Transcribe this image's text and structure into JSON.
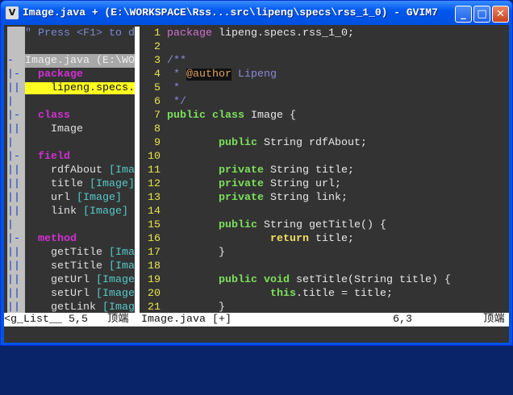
{
  "window": {
    "title": "Image.java + (E:\\WORKSPACE\\Rss...src\\lipeng\\specs\\rss_1_0) - GVIM7",
    "minimize": "_",
    "maximize": "□",
    "close": "✕",
    "icon": "vim-icon"
  },
  "taglist": {
    "lines": [
      {
        "fold": "",
        "text": "\" Press <F1> to d",
        "cls": "help"
      },
      {
        "fold": "",
        "text": "",
        "cls": ""
      },
      {
        "fold": "-",
        "text": "Image.java (E:\\WO",
        "cls": "hdr"
      },
      {
        "fold": "|-",
        "text": "  package",
        "cls": "mg"
      },
      {
        "fold": "||",
        "text": "    lipeng.specs.",
        "cls": "hl"
      },
      {
        "fold": "|",
        "text": "",
        "cls": ""
      },
      {
        "fold": "|-",
        "text": "  class",
        "cls": "mg"
      },
      {
        "fold": "||",
        "text": "    Image",
        "cls": ""
      },
      {
        "fold": "|",
        "text": "",
        "cls": ""
      },
      {
        "fold": "|-",
        "text": "  field",
        "cls": "mg"
      },
      {
        "fold": "||",
        "text": "    rdfAbout ",
        "cls": "",
        "tag": "[Ima"
      },
      {
        "fold": "||",
        "text": "    title ",
        "cls": "",
        "tag": "[Image]"
      },
      {
        "fold": "||",
        "text": "    url ",
        "cls": "",
        "tag": "[Image]"
      },
      {
        "fold": "||",
        "text": "    link ",
        "cls": "",
        "tag": "[Image]"
      },
      {
        "fold": "|",
        "text": "",
        "cls": ""
      },
      {
        "fold": "|-",
        "text": "  method",
        "cls": "mg"
      },
      {
        "fold": "||",
        "text": "    getTitle ",
        "cls": "",
        "tag": "[Ima"
      },
      {
        "fold": "||",
        "text": "    setTitle ",
        "cls": "",
        "tag": "[Ima"
      },
      {
        "fold": "||",
        "text": "    getUrl ",
        "cls": "",
        "tag": "[Image"
      },
      {
        "fold": "||",
        "text": "    setUrl ",
        "cls": "",
        "tag": "[Image"
      },
      {
        "fold": "||",
        "text": "    getLink ",
        "cls": "",
        "tag": "[Imag"
      }
    ],
    "status": "<g_List__ 5,5   顶端"
  },
  "editor": {
    "lines": [
      {
        "n": "1",
        "segs": [
          [
            "package",
            "pp"
          ],
          [
            " lipeng.specs.rss_1_0;",
            ""
          ]
        ]
      },
      {
        "n": "2",
        "segs": []
      },
      {
        "n": "3",
        "segs": [
          [
            "/**",
            "cmt"
          ]
        ]
      },
      {
        "n": "4",
        "segs": [
          [
            " * ",
            "cmt"
          ],
          [
            "@author",
            "tag"
          ],
          [
            " Lipeng",
            "cmt"
          ]
        ]
      },
      {
        "n": "5",
        "segs": [
          [
            " *",
            "cmt"
          ]
        ]
      },
      {
        "n": "6",
        "segs": [
          [
            " */",
            "cmt"
          ]
        ]
      },
      {
        "n": "7",
        "segs": [
          [
            "public",
            "kw"
          ],
          [
            " ",
            ""
          ],
          [
            "class",
            "kw"
          ],
          [
            " Image {",
            ""
          ]
        ]
      },
      {
        "n": "8",
        "segs": []
      },
      {
        "n": "9",
        "segs": [
          [
            "        ",
            ""
          ],
          [
            "public",
            "kw"
          ],
          [
            " String rdfAbout;",
            ""
          ]
        ]
      },
      {
        "n": "10",
        "segs": []
      },
      {
        "n": "11",
        "segs": [
          [
            "        ",
            ""
          ],
          [
            "private",
            "kw"
          ],
          [
            " String title;",
            ""
          ]
        ]
      },
      {
        "n": "12",
        "segs": [
          [
            "        ",
            ""
          ],
          [
            "private",
            "kw"
          ],
          [
            " String url;",
            ""
          ]
        ]
      },
      {
        "n": "13",
        "segs": [
          [
            "        ",
            ""
          ],
          [
            "private",
            "kw"
          ],
          [
            " String link;",
            ""
          ]
        ]
      },
      {
        "n": "14",
        "segs": []
      },
      {
        "n": "15",
        "segs": [
          [
            "        ",
            ""
          ],
          [
            "public",
            "kw"
          ],
          [
            " String getTitle() {",
            ""
          ]
        ]
      },
      {
        "n": "16",
        "segs": [
          [
            "                ",
            ""
          ],
          [
            "return",
            "ret"
          ],
          [
            " title;",
            ""
          ]
        ]
      },
      {
        "n": "17",
        "segs": [
          [
            "        }",
            ""
          ]
        ]
      },
      {
        "n": "18",
        "segs": []
      },
      {
        "n": "19",
        "segs": [
          [
            "        ",
            ""
          ],
          [
            "public",
            "kw"
          ],
          [
            " ",
            ""
          ],
          [
            "void",
            "kw"
          ],
          [
            " setTitle(String title) {",
            ""
          ]
        ]
      },
      {
        "n": "20",
        "segs": [
          [
            "                ",
            ""
          ],
          [
            "this",
            "kw"
          ],
          [
            ".title = title;",
            ""
          ]
        ]
      },
      {
        "n": "21",
        "segs": [
          [
            "        }",
            ""
          ]
        ]
      }
    ],
    "status_file": "Image.java [+]",
    "status_pos": "6,3",
    "status_scroll": "顶端"
  }
}
